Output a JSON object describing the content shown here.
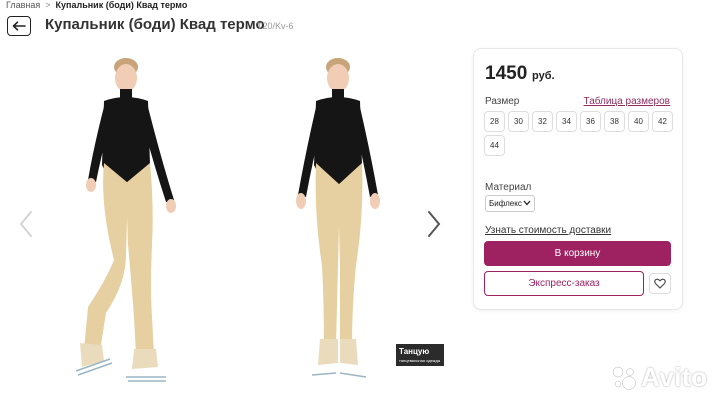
{
  "breadcrumb": {
    "home": "Главная",
    "separator": ">",
    "current": "Купальник (боди) Квад термо"
  },
  "header": {
    "title": "Купальник (боди) Квад термо",
    "sku": "T20/Kv-6"
  },
  "gallery": {
    "watermark_line1": "Танцую",
    "watermark_line2": "танцевальная одежда"
  },
  "product": {
    "price": "1450",
    "currency": "руб.",
    "size_label": "Размер",
    "size_table_link": "Таблица размеров",
    "sizes": [
      "28",
      "30",
      "32",
      "34",
      "36",
      "38",
      "40",
      "42",
      "44"
    ],
    "material_label": "Материал",
    "material_value": "Бифлекс",
    "delivery_link": "Узнать стоимость доставки",
    "cart_button": "В корзину",
    "express_button": "Экспресс-заказ"
  },
  "watermark": {
    "brand": "Avito"
  },
  "colors": {
    "accent": "#9e2162",
    "link": "#8f2b61",
    "bodysuit": "#151515",
    "tights": "#e6cfa0",
    "skin": "#f0cdb4"
  },
  "icons": {
    "back": "arrow-left-icon",
    "prev": "chevron-left-icon",
    "next": "chevron-right-icon",
    "favorite": "heart-icon",
    "select": "chevron-down-icon"
  }
}
